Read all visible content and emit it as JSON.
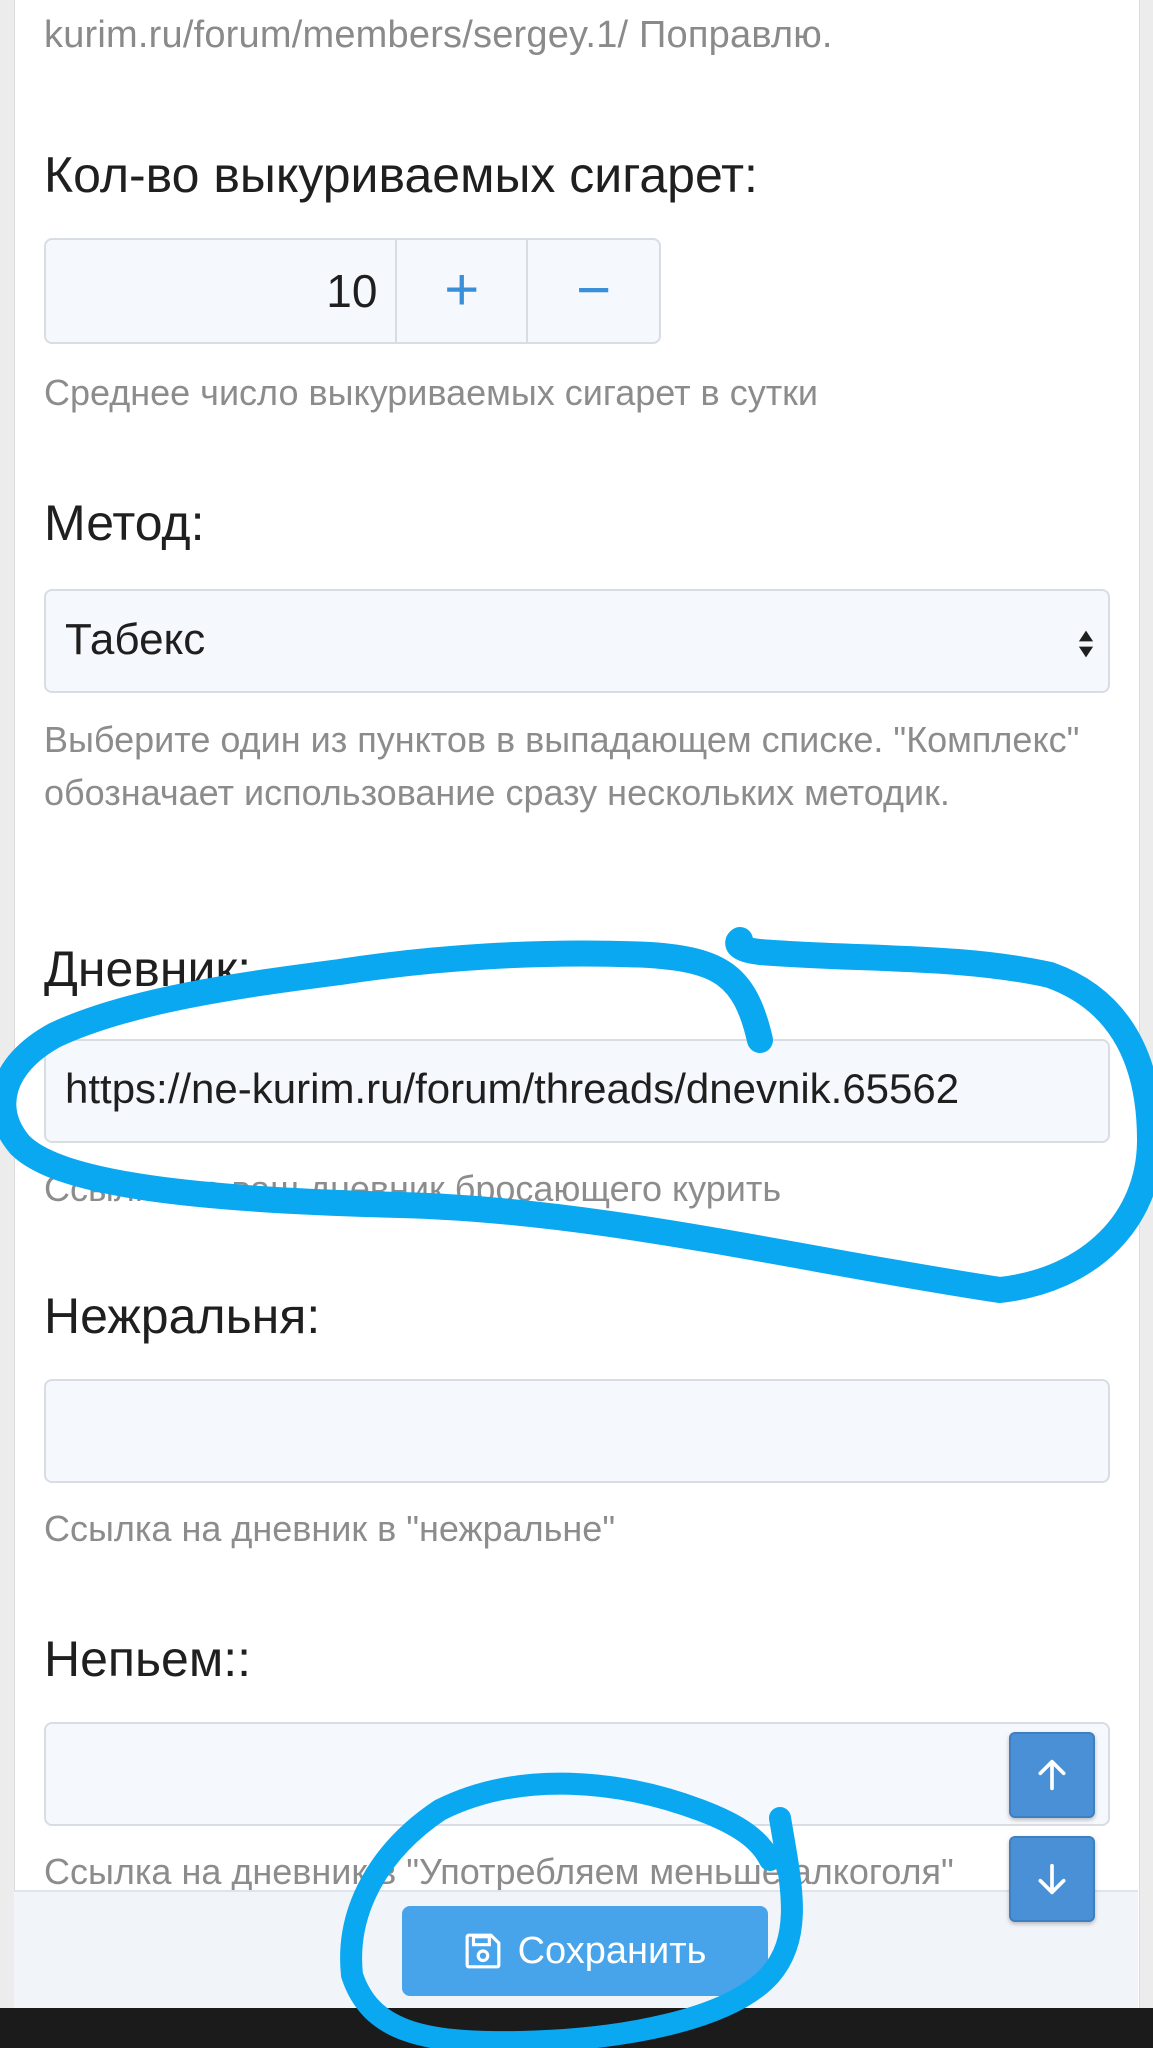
{
  "top": {
    "text": "kurim.ru/forum/members/sergey.1/ Поправлю."
  },
  "cigarettes": {
    "label": "Кол-во выкуриваемых сигарет:",
    "value": "10",
    "plus": "+",
    "minus": "−",
    "hint": "Среднее число выкуриваемых сигарет в сутки"
  },
  "method": {
    "label": "Метод:",
    "selected": "Табекс",
    "hint": "Выберите один из пунктов в выпадающем списке. \"Комплекс\" обозначает использование сразу нескольких методик."
  },
  "diary": {
    "label": "Дневник:",
    "value": "https://ne-kurim.ru/forum/threads/dnevnik.65562",
    "hint": "Ссылка на ваш дневник бросающего курить"
  },
  "nezhralnya": {
    "label": "Нежральня:",
    "value": "",
    "hint": "Ссылка на дневник в \"нежральне\""
  },
  "nepyem": {
    "label": "Непьем::",
    "value": "",
    "hint": "Ссылка на дневник в \"Употребляем меньше алкоголя\""
  },
  "footer": {
    "save_label": "Сохранить"
  },
  "colors": {
    "accent": "#47a3ea",
    "scroll_button": "#4a90d6",
    "annotation": "#0aa8f0"
  },
  "icons": {
    "save": "floppy-disk-icon",
    "scroll_up": "arrow-up-icon",
    "scroll_down": "arrow-down-icon",
    "select": "select-arrows-icon"
  }
}
